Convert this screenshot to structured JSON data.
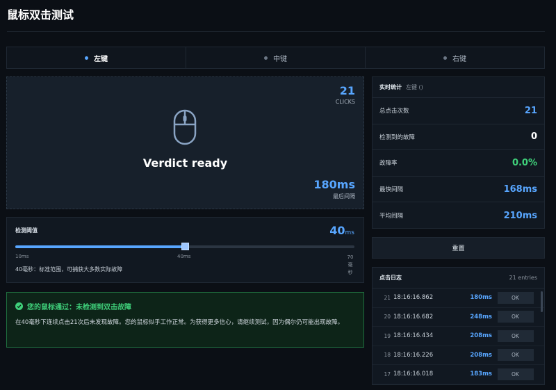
{
  "page": {
    "title": "鼠标双击测试"
  },
  "tabs": [
    {
      "label": "左键",
      "active": true
    },
    {
      "label": "中键",
      "active": false
    },
    {
      "label": "右键",
      "active": false
    }
  ],
  "click_area": {
    "count": "21",
    "count_label": "CLICKS",
    "verdict": "Verdict ready",
    "last_interval": "180ms",
    "last_interval_label": "最后间隔"
  },
  "threshold": {
    "label": "检测阈值",
    "value": "40",
    "unit": "ms",
    "slider_fraction": 0.5,
    "tick_min": "10ms",
    "tick_mid": "40ms",
    "tick_max": "70毫秒",
    "description": "40毫秒：标准范围，可捕获大多数实际故障"
  },
  "result": {
    "title": "您的鼠标通过：未检测到双击故障",
    "body": "在40毫秒下连续点击21次后未发现故障。您的鼠标似乎工作正常。为获得更多信心，请继续测试，因为偶尔仍可能出现故障。"
  },
  "stats": {
    "header": "实时统计",
    "subheader": "左键 ()",
    "rows": [
      {
        "label": "总点击次数",
        "value": "21",
        "color": "#58a6ff"
      },
      {
        "label": "检测到的故障",
        "value": "0",
        "color": "#ffffff"
      },
      {
        "label": "故障率",
        "value": "0.0%",
        "color": "#3fd07a"
      },
      {
        "label": "最快间隔",
        "value": "168ms",
        "color": "#58a6ff"
      },
      {
        "label": "平均间隔",
        "value": "210ms",
        "color": "#58a6ff"
      }
    ]
  },
  "reset_label": "重置",
  "log": {
    "header": "点击日志",
    "count": "21 entries",
    "entries": [
      {
        "idx": "21",
        "time": "18:16:16.862",
        "ms": "180ms",
        "status": "OK"
      },
      {
        "idx": "20",
        "time": "18:16:16.682",
        "ms": "248ms",
        "status": "OK"
      },
      {
        "idx": "19",
        "time": "18:16:16.434",
        "ms": "208ms",
        "status": "OK"
      },
      {
        "idx": "18",
        "time": "18:16:16.226",
        "ms": "208ms",
        "status": "OK"
      },
      {
        "idx": "17",
        "time": "18:16:16.018",
        "ms": "183ms",
        "status": "OK"
      }
    ]
  },
  "colors": {
    "accent": "#58a6ff",
    "success": "#3fd07a",
    "background": "#0b0f15"
  }
}
